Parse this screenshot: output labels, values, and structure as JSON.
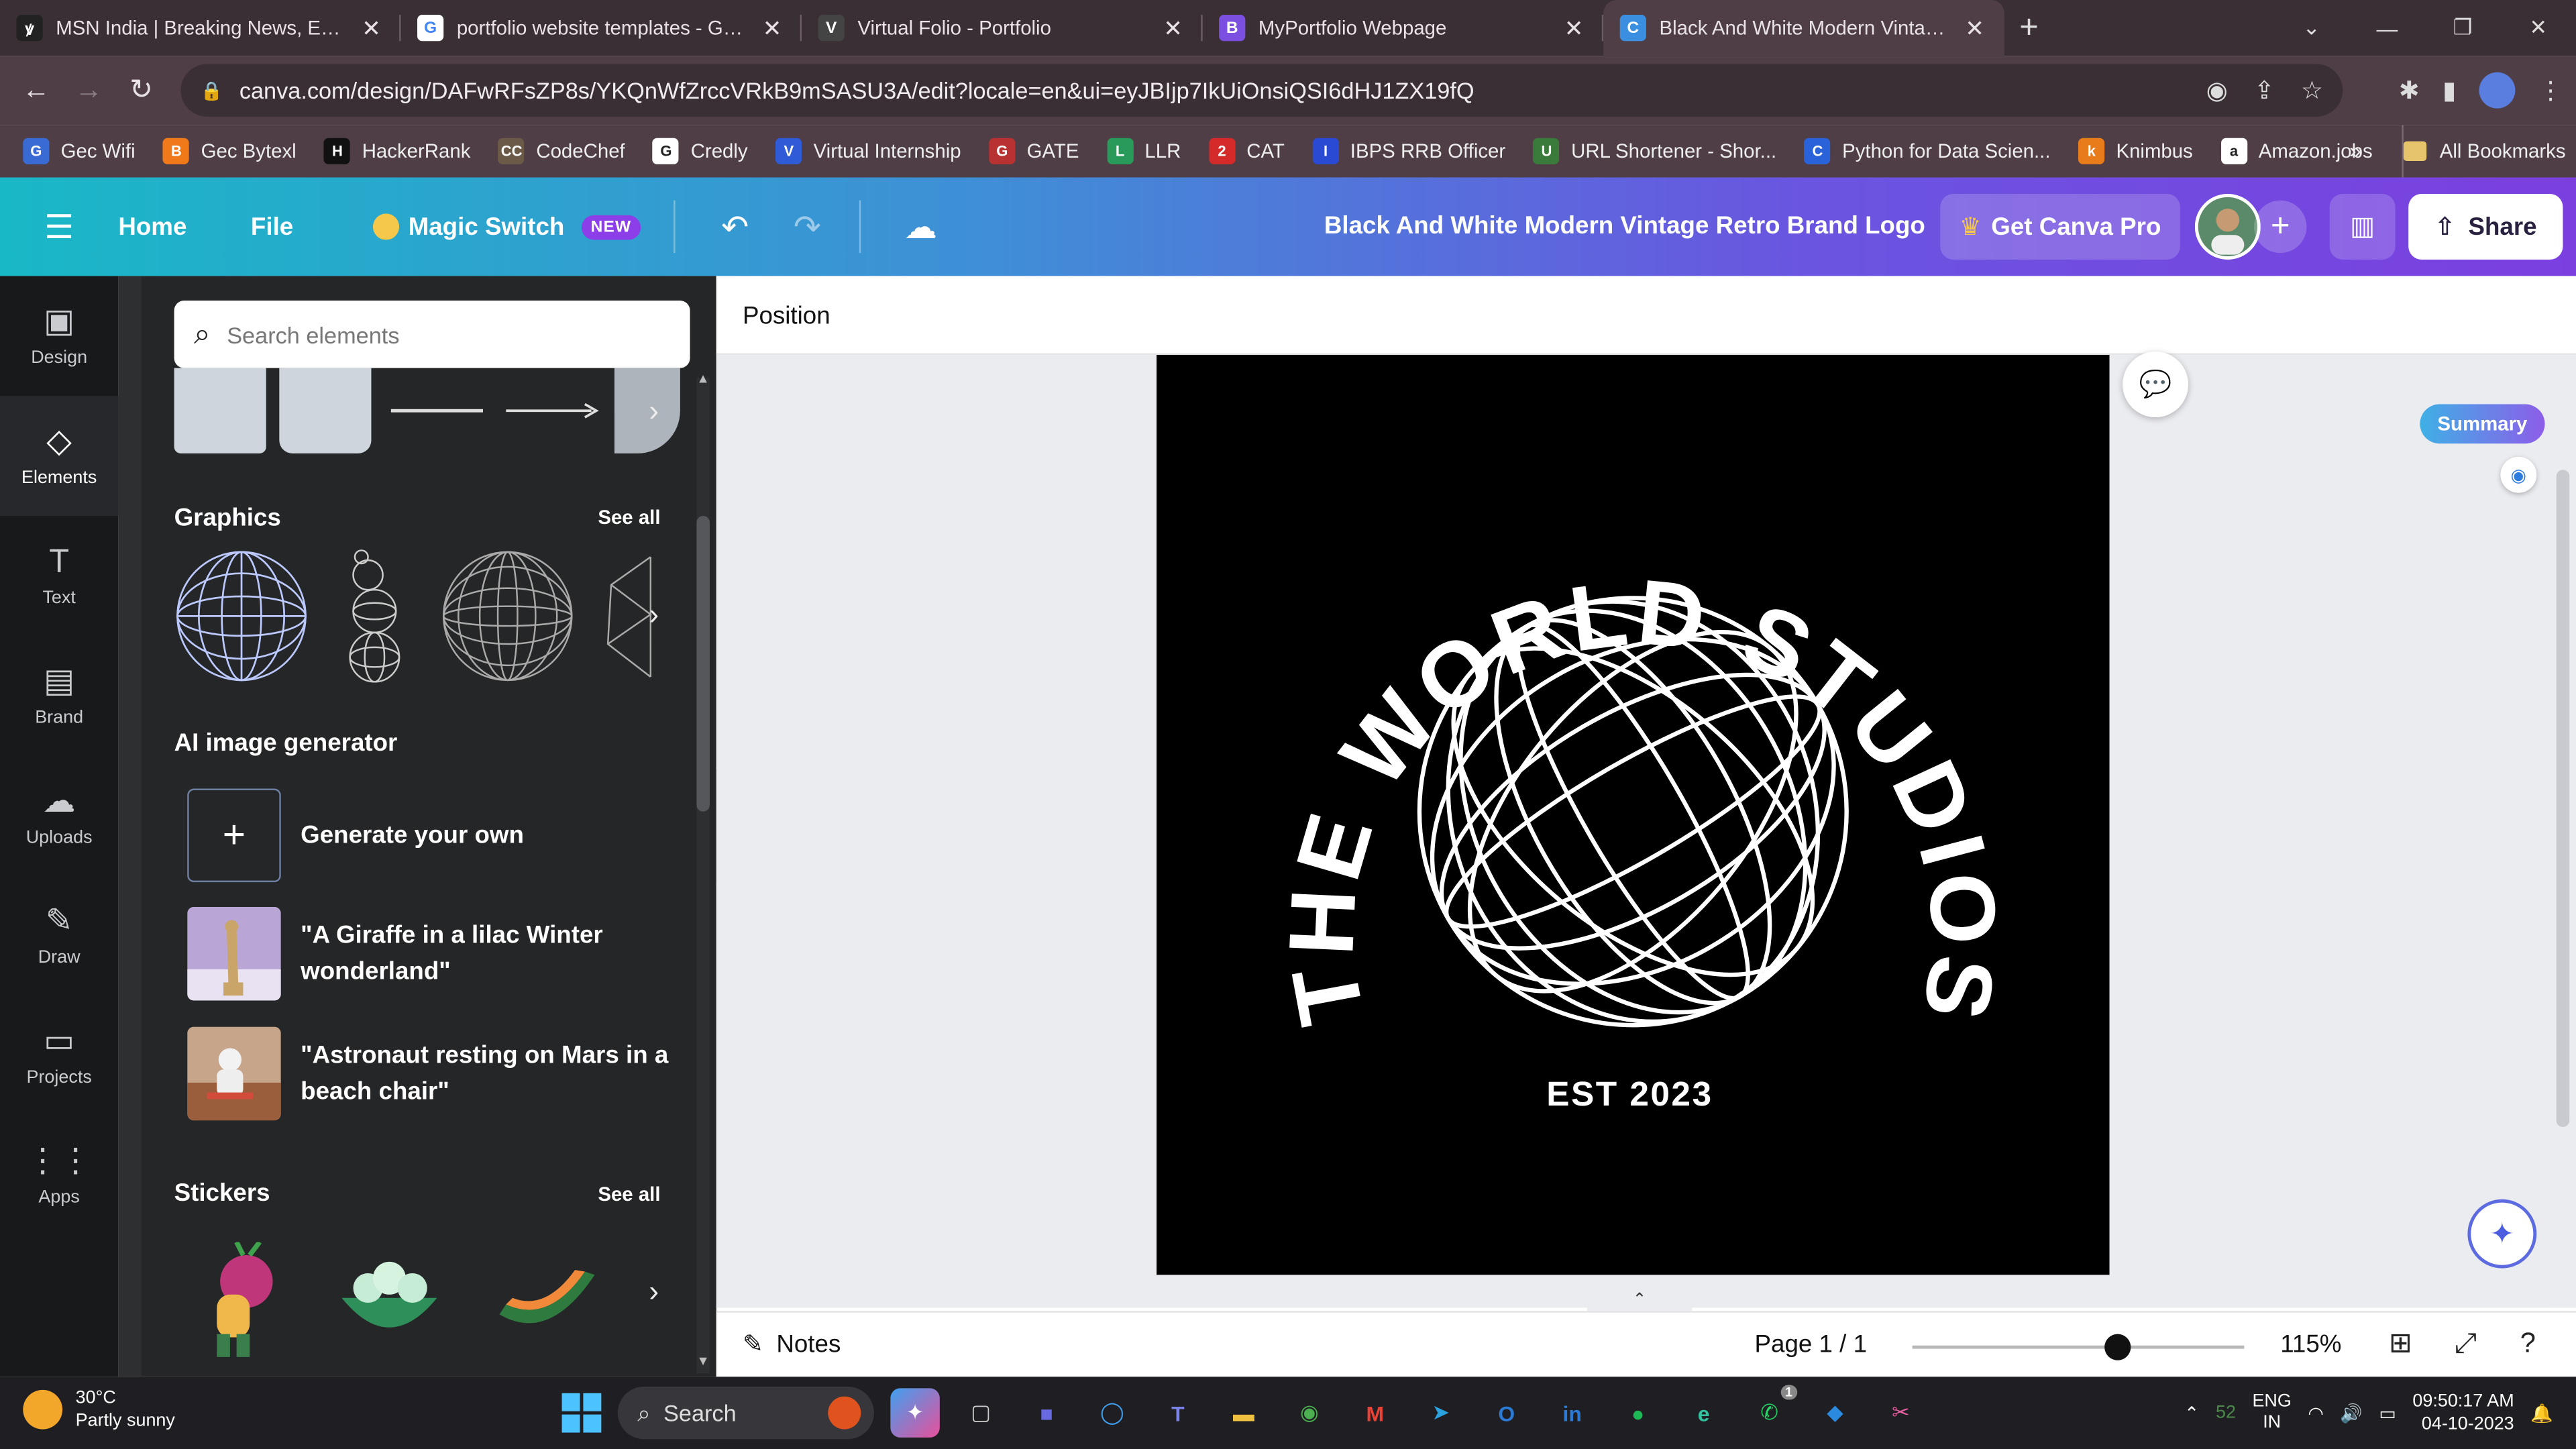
{
  "browser": {
    "tabs": [
      {
        "title": "MSN India | Breaking News, Entertainment",
        "favicon": "msn",
        "color": "#222",
        "active": false
      },
      {
        "title": "portfolio website templates - Google Search",
        "favicon": "G",
        "color": "#fff",
        "active": false
      },
      {
        "title": "Virtual Folio - Portfolio",
        "favicon": "V",
        "color": "#444",
        "active": false
      },
      {
        "title": "MyPortfolio Webpage",
        "favicon": "B",
        "color": "#7b4fe0",
        "active": false
      },
      {
        "title": "Black And White Modern Vintage Retro",
        "favicon": "C",
        "color": "#3a8fe0",
        "active": true
      }
    ],
    "new_tab_icon": "plus-icon",
    "url": "canva.com/design/DAFwRFsZP8s/YKQnWfZrccVRkB9mSASU3A/edit?locale=en&ui=eyJBIjp7IkUiOnsiQSI6dHJ1ZX19fQ",
    "bookmarks": [
      {
        "label": "Gec Wifi",
        "color": "#3a6ad4",
        "glyph": "G"
      },
      {
        "label": "Gec Bytexl",
        "color": "#f07a1a",
        "glyph": "B"
      },
      {
        "label": "HackerRank",
        "color": "#111",
        "glyph": "H"
      },
      {
        "label": "CodeChef",
        "color": "#6b5a48",
        "glyph": "CC"
      },
      {
        "label": "Credly",
        "color": "#fff",
        "glyph": "G"
      },
      {
        "label": "Virtual Internship",
        "color": "#2f5bd6",
        "glyph": "V"
      },
      {
        "label": "GATE",
        "color": "#b83232",
        "glyph": "G"
      },
      {
        "label": "LLR",
        "color": "#2a9a5a",
        "glyph": "L"
      },
      {
        "label": "CAT",
        "color": "#d42a2a",
        "glyph": "2"
      },
      {
        "label": "IBPS RRB Officer",
        "color": "#2a4ad4",
        "glyph": "I"
      },
      {
        "label": "URL Shortener - Shor...",
        "color": "#3a7a3a",
        "glyph": "U"
      },
      {
        "label": "Python for Data Scien...",
        "color": "#2a63d9",
        "glyph": "C"
      },
      {
        "label": "Knimbus",
        "color": "#e87b1a",
        "glyph": "k"
      },
      {
        "label": "Amazon.jobs",
        "color": "#fff",
        "glyph": "a"
      }
    ],
    "bookmarks_more": "»",
    "all_bookmarks": "All Bookmarks"
  },
  "canva": {
    "nav": {
      "home": "Home",
      "file": "File",
      "magic_switch": "Magic Switch",
      "new_badge": "NEW"
    },
    "doc_title": "Black And White Modern Vintage Retro Brand Logo",
    "get_pro": "Get Canva Pro",
    "share": "Share",
    "rail": [
      {
        "label": "Design",
        "icon": "layout-icon",
        "glyph": "▣",
        "active": false
      },
      {
        "label": "Elements",
        "icon": "shapes-icon",
        "glyph": "◇",
        "active": true
      },
      {
        "label": "Text",
        "icon": "text-icon",
        "glyph": "T",
        "active": false
      },
      {
        "label": "Brand",
        "icon": "brand-icon",
        "glyph": "▤",
        "active": false
      },
      {
        "label": "Uploads",
        "icon": "cloud-upload-icon",
        "glyph": "☁",
        "active": false
      },
      {
        "label": "Draw",
        "icon": "pen-icon",
        "glyph": "✎",
        "active": false
      },
      {
        "label": "Projects",
        "icon": "folder-icon",
        "glyph": "▭",
        "active": false
      },
      {
        "label": "Apps",
        "icon": "grid-icon",
        "glyph": "⋮⋮",
        "active": false
      }
    ],
    "panel": {
      "search_placeholder": "Search elements",
      "graphics_title": "Graphics",
      "see_all": "See all",
      "ai_title": "AI image generator",
      "generate_label": "Generate your own",
      "prompts": [
        "\"A Giraffe in a lilac Winter wonderland\"",
        "\"Astronaut resting on Mars in a beach chair\""
      ],
      "stickers_title": "Stickers"
    },
    "position_label": "Position",
    "summary_label": "Summary",
    "design": {
      "brand_text": "THE WORLD STUDIOS",
      "est_text": "EST 2023"
    },
    "footer": {
      "notes": "Notes",
      "page": "Page 1 / 1",
      "zoom": "115%",
      "zoom_level": 0.62
    }
  },
  "taskbar": {
    "weather_temp": "30°C",
    "weather_desc": "Partly sunny",
    "search": "Search",
    "badge_count": "52",
    "lang_line1": "ENG",
    "lang_line2": "IN",
    "time": "09:50:17 AM",
    "date": "04-10-2023",
    "whatsapp_badge": "1"
  }
}
